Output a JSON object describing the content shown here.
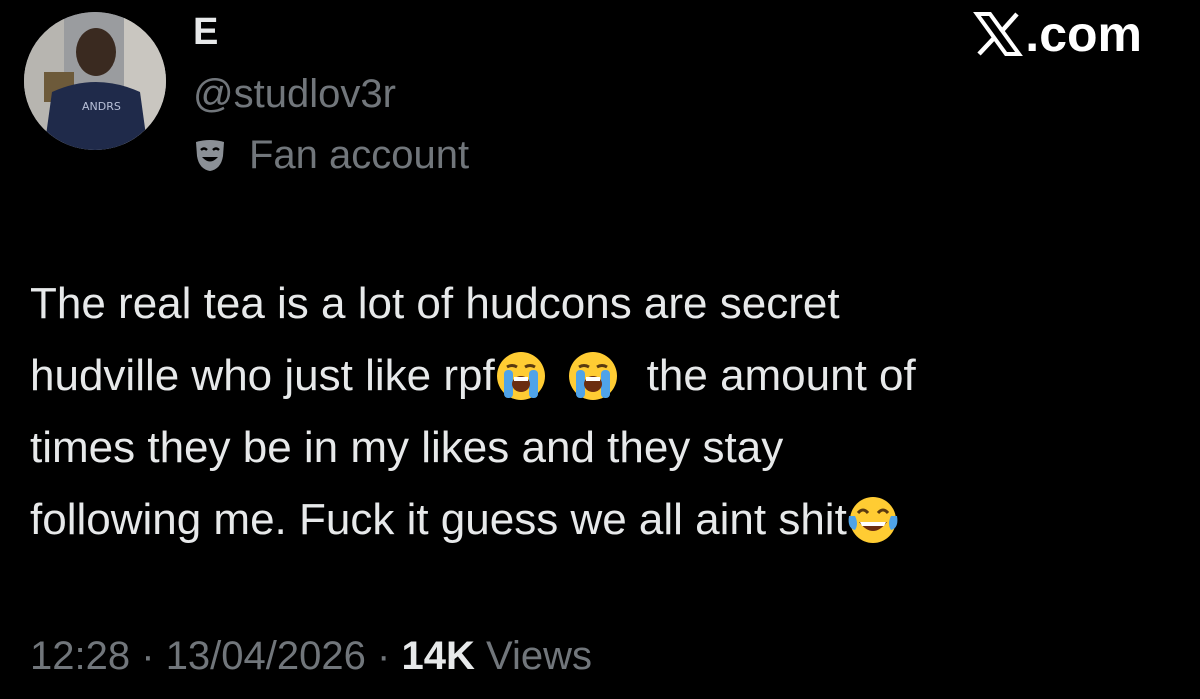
{
  "brand": {
    "text": ".com",
    "logo_icon": "x-logo-icon"
  },
  "author": {
    "display_name": "E",
    "handle": "@studlov3r",
    "label_icon": "theater-mask-icon",
    "label": "Fan account",
    "avatar": "avatar-photo"
  },
  "tweet": {
    "lines": [
      {
        "text": "The real tea is a lot of hudcons are secret"
      },
      {
        "before_emoji": "hudville who just like rpf",
        "emoji_1": "loudly-crying-face-emoji",
        "emoji_2": "loudly-crying-face-emoji",
        "after_emoji": "the amount of"
      },
      {
        "text": "times they be in my likes and they stay"
      },
      {
        "before_emoji": "following me. Fuck it guess we all aint shit",
        "emoji_1": "face-with-tears-of-joy-emoji"
      }
    ]
  },
  "meta": {
    "time": "12:28",
    "separator": "·",
    "date": "13/04/2026",
    "views_count": "14K",
    "views_label": "Views"
  },
  "colors": {
    "background": "#000000",
    "primary_text": "#e7e9ea",
    "secondary_text": "#71767b",
    "emoji_yellow": "#ffcc33",
    "emoji_tears": "#4fa3e8"
  }
}
